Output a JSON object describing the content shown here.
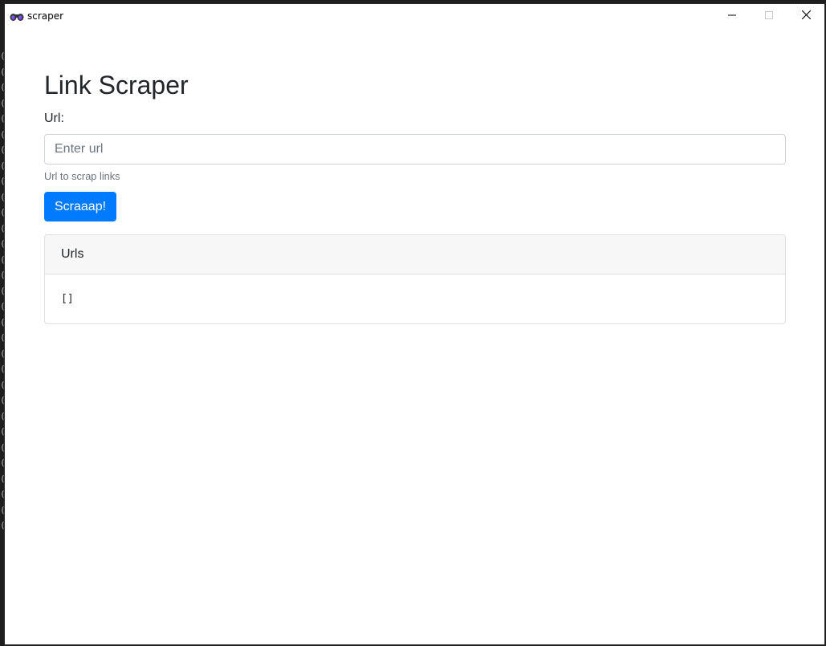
{
  "window": {
    "title": "scraper",
    "icon": "binoculars-icon",
    "controls": [
      "minimize-icon",
      "maximize-icon",
      "close-icon"
    ]
  },
  "page": {
    "heading": "Link Scraper",
    "url_label": "Url:",
    "url_input": {
      "placeholder": "Enter url",
      "value": ""
    },
    "help_text": "Url to scrap links",
    "submit_label": "Scraaap!"
  },
  "urls_card": {
    "header": "Urls",
    "body": "[]"
  },
  "colors": {
    "primary": "#007bff",
    "card_header_bg": "#f7f7f7",
    "muted_text": "#6c757d"
  }
}
